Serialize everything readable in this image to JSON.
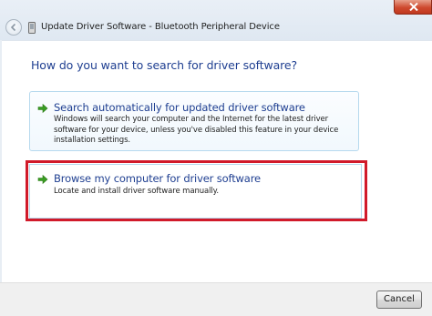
{
  "window": {
    "title": "Update Driver Software - Bluetooth Peripheral Device"
  },
  "heading": "How do you want to search for driver software?",
  "options": [
    {
      "title": "Search automatically for updated driver software",
      "description": "Windows will search your computer and the Internet for the latest driver software for your device, unless you've disabled this feature in your device installation settings.",
      "icon": "green-arrow-icon"
    },
    {
      "title": "Browse my computer for driver software",
      "description": "Locate and install driver software manually.",
      "icon": "green-arrow-icon",
      "highlighted": true
    }
  ],
  "footer": {
    "cancel_label": "Cancel"
  },
  "colors": {
    "link_blue": "#1f3f91",
    "highlight_red": "#d11a2a",
    "option_border": "#b6d9ee",
    "arrow_green": "#3a9d23"
  }
}
